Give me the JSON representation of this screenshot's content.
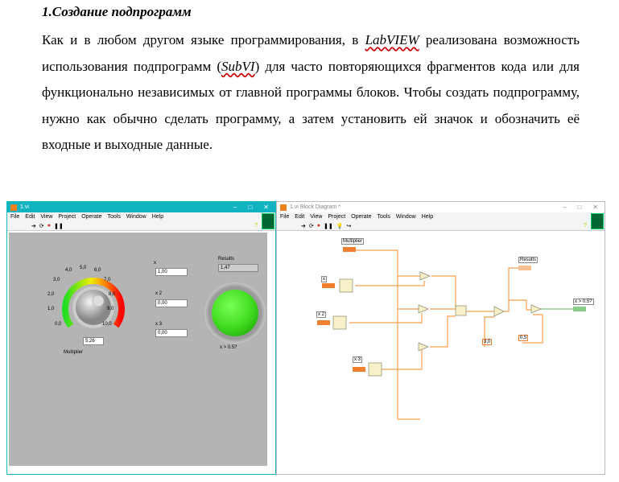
{
  "heading": "1.Создание подпрограмм",
  "paragraph": {
    "before_labview": "Как и в любом другом языке программирования, в ",
    "labview": "LabVIEW",
    "after_labview": " реализована возможность использования подпрограмм (",
    "subvi": "SubVI",
    "rest": ") для часто повторяющихся фрагментов кода или для функционально независимых от главной программы блоков. Чтобы создать подпрограмму, нужно как обычно сделать программу, а затем установить ей значок и обозначить её входные и выходные данные."
  },
  "menu": [
    "File",
    "Edit",
    "View",
    "Project",
    "Operate",
    "Tools",
    "Window",
    "Help"
  ],
  "front_panel": {
    "title": "1.vi",
    "knob_ticks": [
      "0,0",
      "1,0",
      "2,0",
      "3,0",
      "4,0",
      "5,0",
      "6,0",
      "7,0",
      "8,0",
      "9,0",
      "10,0"
    ],
    "multiplier_value": "5,26",
    "multiplier_label": "Multiplier",
    "x_label": "x",
    "x_value": "1,00",
    "x2_label": "x 2",
    "x2_value": "0,00",
    "x3_label": "x 3",
    "x3_value": "0,00",
    "results_label": "Results",
    "results_value": "1,47",
    "led_label": "x > 0.5?",
    "led_color": "#44dd22"
  },
  "block_diagram": {
    "title": "1.vi Block Diagram *",
    "labels": {
      "multiplier": "Multiplier",
      "x": "x",
      "x2": "x 2",
      "x3": "x 3",
      "results": "Results",
      "out": "x > 0.5?",
      "const3": "3,0",
      "const05": "0,5"
    },
    "wire_color": "#f5a050"
  }
}
